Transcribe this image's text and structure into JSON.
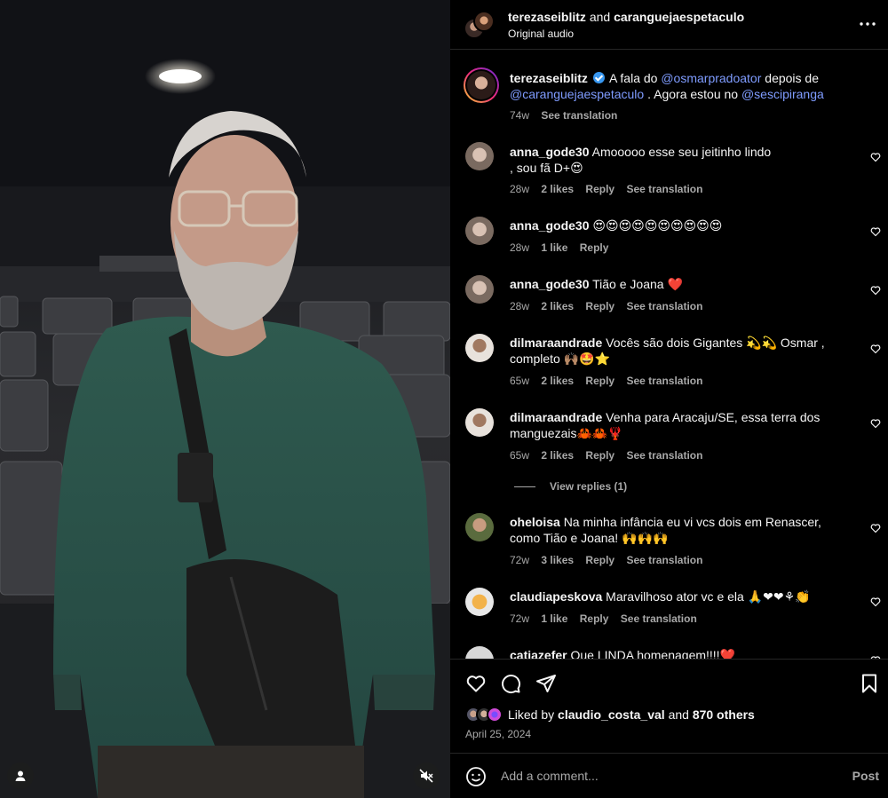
{
  "header": {
    "author": "terezaseiblitz",
    "connector": "and",
    "coauthor": "caranguejaespetaculo",
    "audio": "Original audio"
  },
  "caption": {
    "username": "terezaseiblitz",
    "part1": "A fala do",
    "mention1": "@osmarpradoator",
    "part2": "depois de",
    "mention2": "@caranguejaespetaculo",
    "part3": ". Agora estou no",
    "mention3": "@sescipiranga",
    "time": "74w",
    "translate": "See translation"
  },
  "comments": [
    {
      "username": "anna_gode30",
      "text": "Amooooo esse seu jeitinho lindo , sou fã D+😍",
      "time": "28w",
      "likes": "2 likes",
      "reply": "Reply",
      "translate": "See translation"
    },
    {
      "username": "anna_gode30",
      "text": "😍😍😍😍😍😍😍😍😍😍",
      "time": "28w",
      "likes": "1 like",
      "reply": "Reply",
      "translate": ""
    },
    {
      "username": "anna_gode30",
      "text": "Tião e Joana ❤️",
      "time": "28w",
      "likes": "2 likes",
      "reply": "Reply",
      "translate": "See translation"
    },
    {
      "username": "dilmaraandrade",
      "text": "Vocês são dois Gigantes 💫💫 Osmar , completo 🙌🏽🤩⭐",
      "time": "65w",
      "likes": "2 likes",
      "reply": "Reply",
      "translate": "See translation"
    },
    {
      "username": "dilmaraandrade",
      "text": "Venha para Aracaju/SE, essa terra dos manguezais🦀🦀🦞",
      "time": "65w",
      "likes": "2 likes",
      "reply": "Reply",
      "translate": "See translation",
      "view_replies": "View replies (1)"
    },
    {
      "username": "oheloisa",
      "text": "Na minha infância eu vi vcs dois em Renascer, como Tião e Joana! 🙌🙌🙌",
      "time": "72w",
      "likes": "3 likes",
      "reply": "Reply",
      "translate": "See translation"
    },
    {
      "username": "claudiapeskova",
      "text": "Maravilhoso ator vc e ela 🙏❤❤⚘👏",
      "time": "72w",
      "likes": "1 like",
      "reply": "Reply",
      "translate": "See translation"
    },
    {
      "username": "catiazefer",
      "text": "Que LINDA homenagem!!!!❤️",
      "time": "",
      "likes": "",
      "reply": "",
      "translate": ""
    }
  ],
  "likes": {
    "prefix": "Liked by",
    "user": "claudio_costa_val",
    "and": "and",
    "others": "870 others"
  },
  "date": "April 25, 2024",
  "composer": {
    "placeholder": "Add a comment...",
    "post": "Post"
  },
  "icons": [
    "more-options-icon",
    "verified-badge-icon",
    "heart-icon",
    "comment-icon",
    "share-icon",
    "bookmark-icon",
    "emoji-icon",
    "user-icon",
    "mute-icon"
  ],
  "colors": {
    "background": "#000000",
    "text": "#f5f5f5",
    "secondary": "#a8a8a8",
    "mention": "#7f9cff",
    "verified": "#3897f0"
  }
}
